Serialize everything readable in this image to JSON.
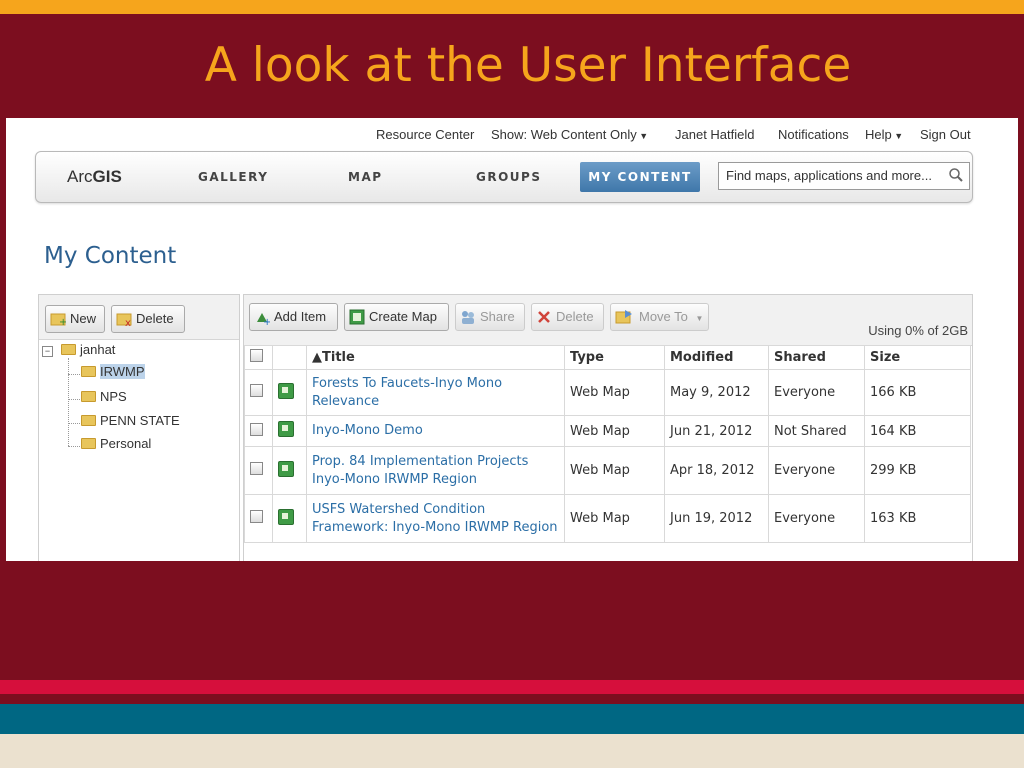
{
  "slide": {
    "title": "A look at the User Interface",
    "colors": {
      "background": "#7c0e1f",
      "title": "#f6a51c",
      "stripe_top": "#f6a51c",
      "band_red": "#d60f3c",
      "band_teal": "#006783",
      "band_cream": "#ebe1cf"
    }
  },
  "util_bar": {
    "resource_center": "Resource Center",
    "show": "Show: Web Content Only",
    "user": "Janet Hatfield",
    "notifications": "Notifications",
    "help": "Help",
    "sign_out": "Sign Out",
    "dropdown_icon": "caret-down-icon"
  },
  "nav": {
    "logo_prefix": "Arc",
    "logo_suffix": "GIS",
    "items": [
      "GALLERY",
      "MAP",
      "GROUPS"
    ],
    "active": "MY CONTENT",
    "active_color": "#4f86b9",
    "search_text": "Find maps, applications and more...",
    "search_icon": "magnifier-icon"
  },
  "page": {
    "heading": "My Content",
    "heading_color": "#2c5f8f"
  },
  "left_toolbar": {
    "new_label": "New",
    "delete_label": "Delete"
  },
  "tree": {
    "root": "janhat",
    "expander": "−",
    "folders": [
      "IRWMP",
      "NPS",
      "PENN STATE",
      "Personal"
    ],
    "selected": "IRWMP"
  },
  "right_toolbar": {
    "add_item": "Add Item",
    "create_map": "Create Map",
    "share": "Share",
    "delete": "Delete",
    "move_to": "Move To",
    "usage": "Using 0% of 2GB"
  },
  "table": {
    "headers": {
      "title": "▲Title",
      "type": "Type",
      "modified": "Modified",
      "shared": "Shared",
      "size": "Size"
    },
    "rows": [
      {
        "title_line1": "Forests To Faucets-Inyo Mono",
        "title_line2": "Relevance",
        "type": "Web Map",
        "modified": "May 9, 2012",
        "shared": "Everyone",
        "size": "166 KB"
      },
      {
        "title_line1": "Inyo-Mono Demo",
        "title_line2": "",
        "type": "Web Map",
        "modified": "Jun 21, 2012",
        "shared": "Not Shared",
        "size": "164 KB"
      },
      {
        "title_line1": "Prop. 84 Implementation Projects",
        "title_line2": "Inyo-Mono IRWMP Region",
        "type": "Web Map",
        "modified": "Apr 18, 2012",
        "shared": "Everyone",
        "size": "299 KB"
      },
      {
        "title_line1": "USFS Watershed Condition",
        "title_line2": "Framework: Inyo-Mono IRWMP Region",
        "type": "Web Map",
        "modified": "Jun 19, 2012",
        "shared": "Everyone",
        "size": "163 KB"
      }
    ]
  }
}
